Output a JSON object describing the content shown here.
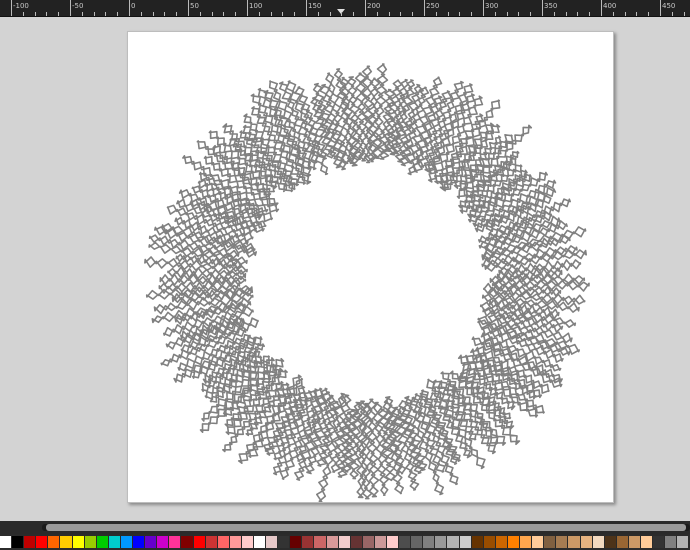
{
  "ruler": {
    "labels": [
      "-100",
      "-50",
      "0",
      "50",
      "100",
      "150",
      "200",
      "250",
      "300",
      "350",
      "400",
      "450"
    ]
  },
  "document": {
    "stroke_color": "#808080",
    "page_color": "#ffffff",
    "shape": "radial-scribble-ring"
  },
  "palette": {
    "colors": [
      "#ffffff",
      "#000000",
      "#c00000",
      "#ff0000",
      "#ff6600",
      "#ffcc00",
      "#ffff00",
      "#99cc00",
      "#00cc00",
      "#00cccc",
      "#0099ff",
      "#0000ff",
      "#6600cc",
      "#cc00cc",
      "#ff3399",
      "#800000",
      "#ff0000",
      "#cc3333",
      "#ff6666",
      "#ff9999",
      "#ffcccc",
      "#ffffff",
      "#e6c8c8",
      "#333333",
      "#660000",
      "#993333",
      "#cc6666",
      "#d99999",
      "#f2cccc",
      "#663333",
      "#996666",
      "#cc9999",
      "#ffcccc",
      "#4d4d4d",
      "#666666",
      "#808080",
      "#999999",
      "#b3b3b3",
      "#cccccc",
      "#663300",
      "#994d00",
      "#cc6600",
      "#ff8000",
      "#ffa64d",
      "#ffcc99",
      "#806040",
      "#a67c52",
      "#cc9966",
      "#e6b380",
      "#f2d9bf",
      "#4d3319",
      "#996633",
      "#cc9966",
      "#ffcc99",
      "#333333",
      "#808080",
      "#b3b3b3"
    ]
  }
}
